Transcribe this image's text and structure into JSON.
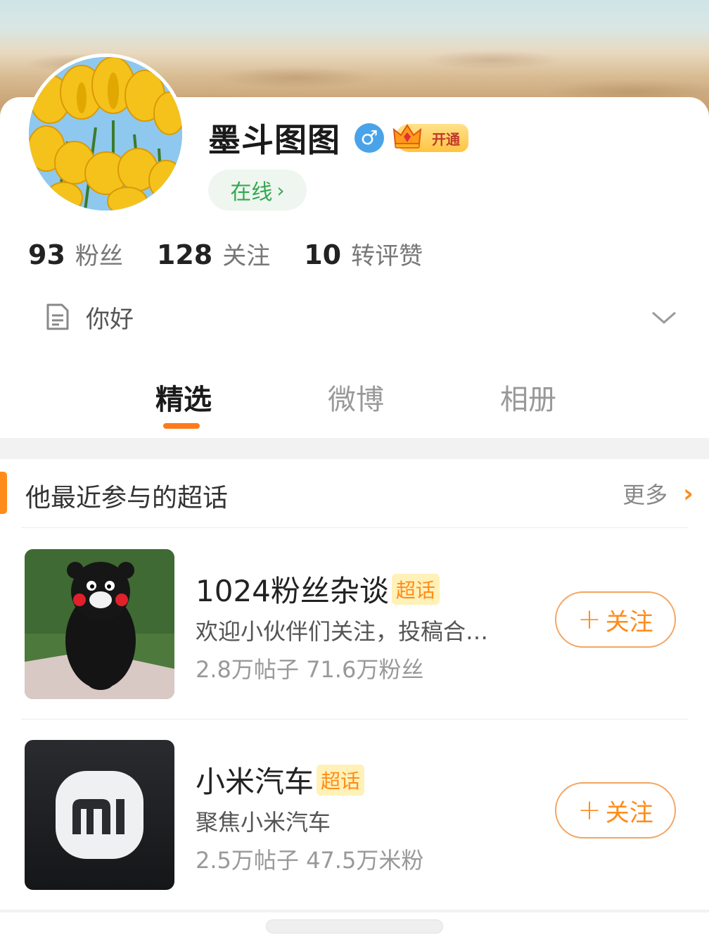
{
  "profile": {
    "name": "墨斗图图",
    "gender_symbol": "♂",
    "vip_label": "开通",
    "online_label": "在线",
    "online_chevron": "›",
    "stats": [
      {
        "num": "93",
        "label": "粉丝"
      },
      {
        "num": "128",
        "label": "关注"
      },
      {
        "num": "10",
        "label": "转评赞"
      }
    ],
    "bio": "你好"
  },
  "tabs": [
    {
      "label": "精选",
      "active": true
    },
    {
      "label": "微博",
      "active": false
    },
    {
      "label": "相册",
      "active": false
    }
  ],
  "section": {
    "title": "他最近参与的超话",
    "more_label": "更多",
    "more_arrow": "›",
    "badge_label": "超话",
    "follow_plus": "+",
    "follow_label": "关注",
    "topics": [
      {
        "title": "1024粉丝杂谈",
        "desc": "欢迎小伙伴们关注，投稿合…",
        "meta": "2.8万帖子 71.6万粉丝",
        "thumb_icon": "kumamon-image"
      },
      {
        "title": "小米汽车",
        "desc": "聚焦小米汽车",
        "meta": "2.5万帖子 47.5万米粉",
        "thumb_icon": "xiaomi-logo"
      }
    ]
  },
  "colors": {
    "accent": "#ff8c1a",
    "online": "#35a853",
    "gender": "#4aa3e8"
  }
}
